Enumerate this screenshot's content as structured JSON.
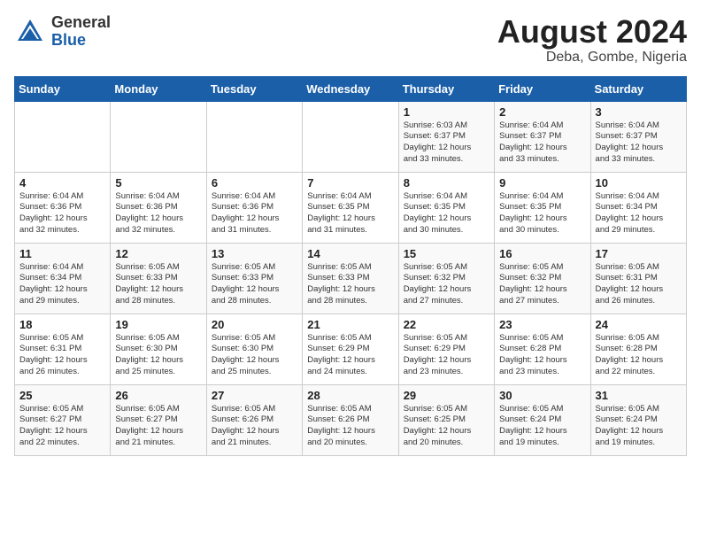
{
  "header": {
    "logo_general": "General",
    "logo_blue": "Blue",
    "title": "August 2024",
    "subtitle": "Deba, Gombe, Nigeria"
  },
  "days_of_week": [
    "Sunday",
    "Monday",
    "Tuesday",
    "Wednesday",
    "Thursday",
    "Friday",
    "Saturday"
  ],
  "weeks": [
    [
      {
        "num": "",
        "info": ""
      },
      {
        "num": "",
        "info": ""
      },
      {
        "num": "",
        "info": ""
      },
      {
        "num": "",
        "info": ""
      },
      {
        "num": "1",
        "info": "Sunrise: 6:03 AM\nSunset: 6:37 PM\nDaylight: 12 hours\nand 33 minutes."
      },
      {
        "num": "2",
        "info": "Sunrise: 6:04 AM\nSunset: 6:37 PM\nDaylight: 12 hours\nand 33 minutes."
      },
      {
        "num": "3",
        "info": "Sunrise: 6:04 AM\nSunset: 6:37 PM\nDaylight: 12 hours\nand 33 minutes."
      }
    ],
    [
      {
        "num": "4",
        "info": "Sunrise: 6:04 AM\nSunset: 6:36 PM\nDaylight: 12 hours\nand 32 minutes."
      },
      {
        "num": "5",
        "info": "Sunrise: 6:04 AM\nSunset: 6:36 PM\nDaylight: 12 hours\nand 32 minutes."
      },
      {
        "num": "6",
        "info": "Sunrise: 6:04 AM\nSunset: 6:36 PM\nDaylight: 12 hours\nand 31 minutes."
      },
      {
        "num": "7",
        "info": "Sunrise: 6:04 AM\nSunset: 6:35 PM\nDaylight: 12 hours\nand 31 minutes."
      },
      {
        "num": "8",
        "info": "Sunrise: 6:04 AM\nSunset: 6:35 PM\nDaylight: 12 hours\nand 30 minutes."
      },
      {
        "num": "9",
        "info": "Sunrise: 6:04 AM\nSunset: 6:35 PM\nDaylight: 12 hours\nand 30 minutes."
      },
      {
        "num": "10",
        "info": "Sunrise: 6:04 AM\nSunset: 6:34 PM\nDaylight: 12 hours\nand 29 minutes."
      }
    ],
    [
      {
        "num": "11",
        "info": "Sunrise: 6:04 AM\nSunset: 6:34 PM\nDaylight: 12 hours\nand 29 minutes."
      },
      {
        "num": "12",
        "info": "Sunrise: 6:05 AM\nSunset: 6:33 PM\nDaylight: 12 hours\nand 28 minutes."
      },
      {
        "num": "13",
        "info": "Sunrise: 6:05 AM\nSunset: 6:33 PM\nDaylight: 12 hours\nand 28 minutes."
      },
      {
        "num": "14",
        "info": "Sunrise: 6:05 AM\nSunset: 6:33 PM\nDaylight: 12 hours\nand 28 minutes."
      },
      {
        "num": "15",
        "info": "Sunrise: 6:05 AM\nSunset: 6:32 PM\nDaylight: 12 hours\nand 27 minutes."
      },
      {
        "num": "16",
        "info": "Sunrise: 6:05 AM\nSunset: 6:32 PM\nDaylight: 12 hours\nand 27 minutes."
      },
      {
        "num": "17",
        "info": "Sunrise: 6:05 AM\nSunset: 6:31 PM\nDaylight: 12 hours\nand 26 minutes."
      }
    ],
    [
      {
        "num": "18",
        "info": "Sunrise: 6:05 AM\nSunset: 6:31 PM\nDaylight: 12 hours\nand 26 minutes."
      },
      {
        "num": "19",
        "info": "Sunrise: 6:05 AM\nSunset: 6:30 PM\nDaylight: 12 hours\nand 25 minutes."
      },
      {
        "num": "20",
        "info": "Sunrise: 6:05 AM\nSunset: 6:30 PM\nDaylight: 12 hours\nand 25 minutes."
      },
      {
        "num": "21",
        "info": "Sunrise: 6:05 AM\nSunset: 6:29 PM\nDaylight: 12 hours\nand 24 minutes."
      },
      {
        "num": "22",
        "info": "Sunrise: 6:05 AM\nSunset: 6:29 PM\nDaylight: 12 hours\nand 23 minutes."
      },
      {
        "num": "23",
        "info": "Sunrise: 6:05 AM\nSunset: 6:28 PM\nDaylight: 12 hours\nand 23 minutes."
      },
      {
        "num": "24",
        "info": "Sunrise: 6:05 AM\nSunset: 6:28 PM\nDaylight: 12 hours\nand 22 minutes."
      }
    ],
    [
      {
        "num": "25",
        "info": "Sunrise: 6:05 AM\nSunset: 6:27 PM\nDaylight: 12 hours\nand 22 minutes."
      },
      {
        "num": "26",
        "info": "Sunrise: 6:05 AM\nSunset: 6:27 PM\nDaylight: 12 hours\nand 21 minutes."
      },
      {
        "num": "27",
        "info": "Sunrise: 6:05 AM\nSunset: 6:26 PM\nDaylight: 12 hours\nand 21 minutes."
      },
      {
        "num": "28",
        "info": "Sunrise: 6:05 AM\nSunset: 6:26 PM\nDaylight: 12 hours\nand 20 minutes."
      },
      {
        "num": "29",
        "info": "Sunrise: 6:05 AM\nSunset: 6:25 PM\nDaylight: 12 hours\nand 20 minutes."
      },
      {
        "num": "30",
        "info": "Sunrise: 6:05 AM\nSunset: 6:24 PM\nDaylight: 12 hours\nand 19 minutes."
      },
      {
        "num": "31",
        "info": "Sunrise: 6:05 AM\nSunset: 6:24 PM\nDaylight: 12 hours\nand 19 minutes."
      }
    ]
  ]
}
